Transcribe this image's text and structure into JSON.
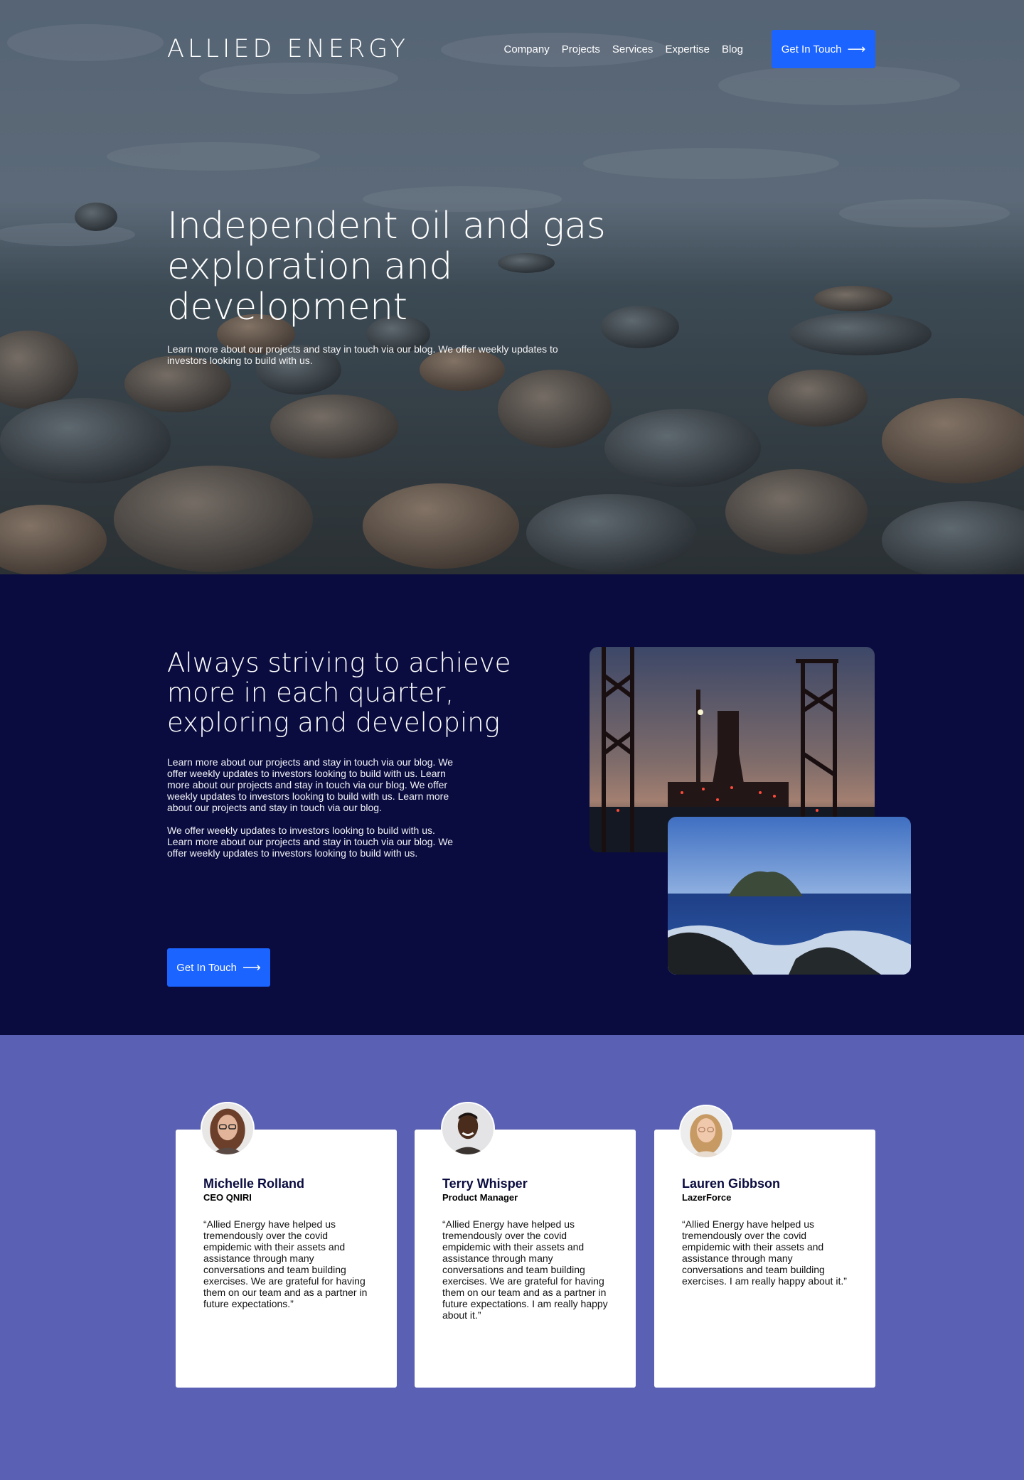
{
  "header": {
    "logo": "ALLIED ENERGY",
    "nav": [
      "Company",
      "Projects",
      "Services",
      "Expertise",
      "Blog"
    ],
    "cta_label": "Get In Touch",
    "cta_icon": "arrow-right-icon"
  },
  "hero": {
    "title": "Independent oil and gas exploration and development",
    "subtitle": "Learn more about our projects and stay in touch via our blog. We offer weekly updates to investors looking to build with us."
  },
  "about": {
    "title": "Always striving to achieve more in each quarter, exploring and developing",
    "paragraph_1": "Learn more about our projects and stay in touch via our blog. We offer weekly updates to investors looking to build with us. Learn more about our projects and stay in touch via our blog. We offer weekly updates to investors looking to build with us. Learn more about our projects and stay in touch via our blog.",
    "paragraph_2": "We offer weekly updates to investors looking to build with us. Learn more about our projects and stay in touch via our blog. We offer weekly updates to investors looking to build with us.",
    "cta_label": "Get In Touch",
    "cta_icon": "arrow-right-icon"
  },
  "testimonials": [
    {
      "name": "Michelle Rolland",
      "role": "CEO QNIRI",
      "quote": "“Allied Energy have helped us tremendously over the covid empidemic with their assets and assistance through many conversations and team building exercises. We are grateful for having them on our team and as a partner in future expectations.”"
    },
    {
      "name": "Terry Whisper",
      "role": "Product Manager",
      "quote": "“Allied Energy have helped us tremendously over the covid empidemic with their assets and assistance through many conversations and team building exercises. We are grateful for having them on our team and as a partner in future expectations. I am really happy about it.”"
    },
    {
      "name": "Lauren Gibbson",
      "role": "LazerForce",
      "quote": "“Allied Energy have helped us tremendously over the covid empidemic with their assets and assistance through many conversations and team building exercises. I am really happy about it.”"
    }
  ],
  "colors": {
    "accent": "#1c64ff",
    "navy": "#0a0c3f",
    "periwinkle": "#5a61b4",
    "name_text": "#0a0c3f"
  }
}
